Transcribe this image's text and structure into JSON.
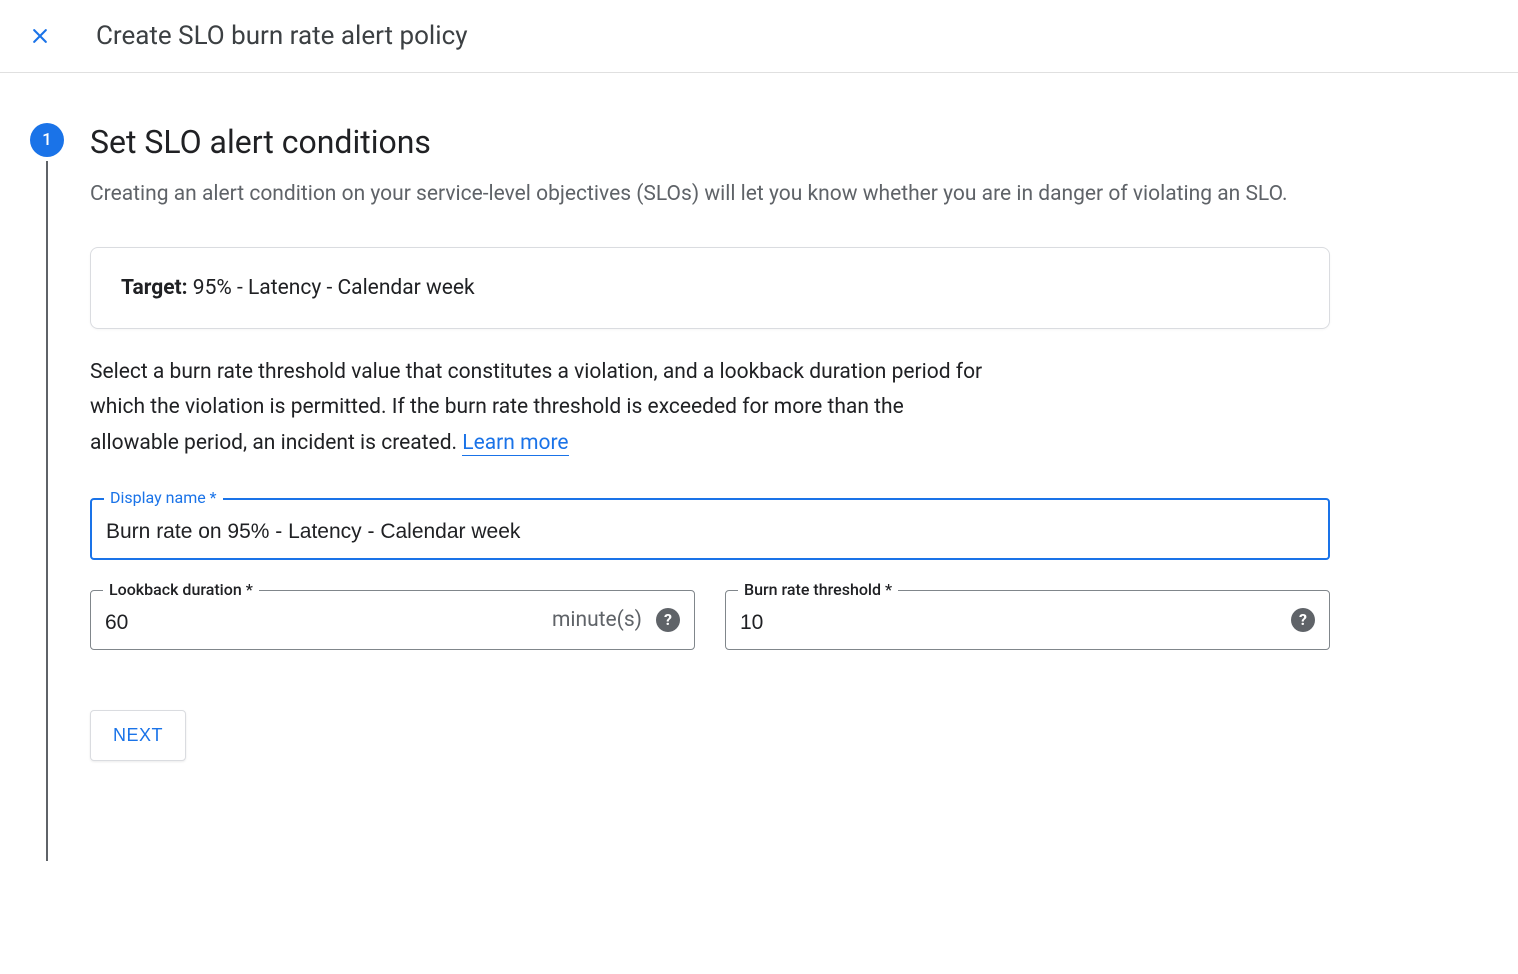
{
  "header": {
    "title": "Create SLO burn rate alert policy"
  },
  "step": {
    "number": "1",
    "title": "Set SLO alert conditions",
    "description": "Creating an alert condition on your service-level objectives (SLOs) will let you know whether you are in danger of violating an SLO.",
    "target_label": "Target:",
    "target_value": " 95% - Latency - Calendar week",
    "instruction_text": "Select a burn rate threshold value that constitutes a violation, and a lookback duration period for which the violation is permitted. If the burn rate threshold is exceeded for more than the allowable period, an incident is created. ",
    "learn_more": "Learn more"
  },
  "fields": {
    "display_name": {
      "label": "Display name *",
      "value": "Burn rate on 95% - Latency - Calendar week"
    },
    "lookback": {
      "label": "Lookback duration *",
      "value": "60",
      "unit": "minute(s)"
    },
    "threshold": {
      "label": "Burn rate threshold *",
      "value": "10"
    }
  },
  "buttons": {
    "next": "NEXT"
  }
}
